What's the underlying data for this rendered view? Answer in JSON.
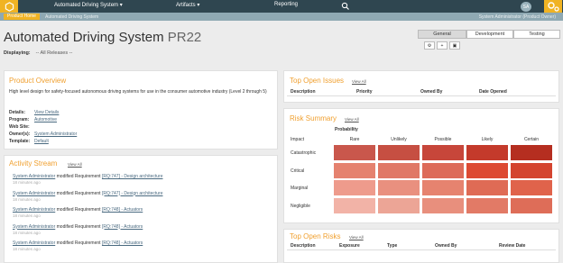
{
  "nav": {
    "project": "Automated Driving System",
    "artifacts": "Artifacts",
    "reporting": "Reporting",
    "user_initials": "SA"
  },
  "breadcrumb": {
    "home": "Product Home",
    "project": "Automated Driving System",
    "user": "System Administrator (Product Owner)"
  },
  "header": {
    "title": "Automated Driving System",
    "code": "PR22",
    "displaying_label": "Displaying:",
    "displaying_value": "-- All Releases --"
  },
  "view_tabs": [
    "General",
    "Development",
    "Testing"
  ],
  "overview": {
    "title": "Product Overview",
    "description": "High level design for safety-focused autonomous driving systems for use in the consumer automotive industry (Level 2 through 5)",
    "details_label": "Details:",
    "details_value": "View Details",
    "program_label": "Program:",
    "program_value": "Automotive",
    "website_label": "Web Site:",
    "website_value": "",
    "owners_label": "Owner(s):",
    "owners_value": "System Administrator",
    "template_label": "Template:",
    "template_value": "Default"
  },
  "activity": {
    "title": "Activity Stream",
    "view_all": "View All",
    "items": [
      {
        "user": "System Administrator",
        "action": " modified Requirement ",
        "link": "[RQ:747] - Design architecture",
        "time": "18 minutes ago"
      },
      {
        "user": "System Administrator",
        "action": " modified Requirement ",
        "link": "[RQ:747] - Design architecture",
        "time": "18 minutes ago"
      },
      {
        "user": "System Administrator",
        "action": " modified Requirement ",
        "link": "[RQ:748] - Actuators",
        "time": "18 minutes ago"
      },
      {
        "user": "System Administrator",
        "action": " modified Requirement ",
        "link": "[RQ:748] - Actuators",
        "time": "18 minutes ago"
      },
      {
        "user": "System Administrator",
        "action": " modified Requirement ",
        "link": "[RQ:748] - Actuators",
        "time": "18 minutes ago"
      }
    ]
  },
  "open_issues": {
    "title": "Top Open Issues",
    "view_all": "View All",
    "columns": [
      "Description",
      "Priority",
      "Owned By",
      "Date Opened"
    ]
  },
  "risk_summary": {
    "title": "Risk Summary",
    "view_all": "View All",
    "probability_label": "Probability",
    "impact_label": "Impact",
    "probabilities": [
      "Rare",
      "Unlikely",
      "Possible",
      "Likely",
      "Certain"
    ],
    "impacts": [
      "Catastrophic",
      "Critical",
      "Marginal",
      "Negligible"
    ],
    "colors": [
      [
        "#c9574c",
        "#c64f42",
        "#c7463a",
        "#c43a2b",
        "#b52e20"
      ],
      [
        "#e5826f",
        "#e07866",
        "#dd6b59",
        "#dd4a33",
        "#d4442f"
      ],
      [
        "#ee9b8c",
        "#e9907f",
        "#e6836f",
        "#df6b55",
        "#e0634b"
      ],
      [
        "#f2b3a7",
        "#eca596",
        "#e88f7d",
        "#e27a66",
        "#de6d58"
      ]
    ]
  },
  "open_risks": {
    "title": "Top Open Risks",
    "view_all": "View All",
    "columns": [
      "Description",
      "Exposure",
      "Type",
      "Owned By",
      "Review Date"
    ]
  }
}
